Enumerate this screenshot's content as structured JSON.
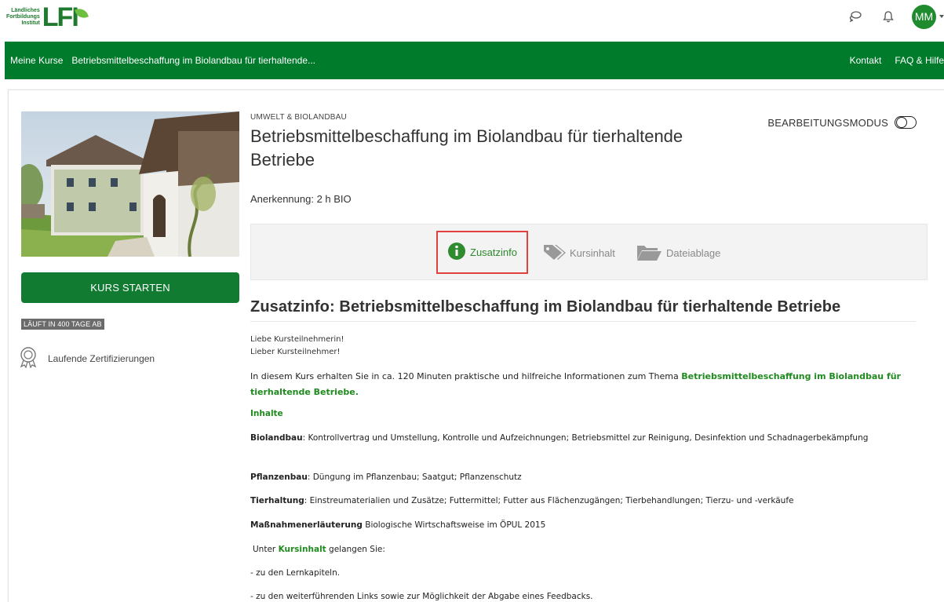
{
  "header": {
    "logo_text": [
      "Ländliches",
      "Fortbildungs",
      "Institut"
    ],
    "logo_mark": "LFI",
    "avatar_initials": "MM",
    "icons": [
      "chat-icon",
      "bell-icon"
    ]
  },
  "nav": {
    "home": "Meine Kurse",
    "breadcrumb": "Betriebsmittelbeschaffung im Biolandbau für tierhaltende...",
    "right": [
      "Kontakt",
      "FAQ & Hilfe"
    ]
  },
  "course": {
    "category": "UMWELT & BIOLANDBAU",
    "title": "Betriebsmittelbeschaffung im Biolandbau für tierhaltende Betriebe",
    "edit_mode_label": "BEARBEITUNGSMODUS",
    "recognition": "Anerkennung: 2 h BIO",
    "start_button": "KURS STARTEN",
    "runs_badge": "LÄUFT IN 400 TAGE AB",
    "certifications": "Laufende Zertifizierungen"
  },
  "tabs": [
    {
      "label": "Zusatzinfo",
      "icon": "info-icon",
      "active": true
    },
    {
      "label": "Kursinhalt",
      "icon": "tags-icon",
      "active": false
    },
    {
      "label": "Dateiablage",
      "icon": "folder-icon",
      "active": false
    }
  ],
  "section": {
    "heading": "Zusatzinfo: Betriebsmittelbeschaffung im Biolandbau für tierhaltende Betriebe",
    "greeting1": "Liebe Kursteilnehmerin!",
    "greeting2": "Lieber Kursteilnehmer!",
    "intro_start": "In diesem Kurs erhalten Sie in ca. 120 Minuten praktische und hilfreiche Informationen zum Thema ",
    "intro_topic": "Betriebsmittelbeschaffung im Biolandbau für tierhaltende Betriebe.",
    "contents_heading": "Inhalte",
    "items": [
      {
        "label": "Biolandbau",
        "text": ": Kontrollvertrag und Umstellung, Kontrolle und Aufzeichnungen; Betriebsmittel zur Reinigung, Desinfektion und Schadnagerbekämpfung"
      },
      {
        "label": "Pflanzenbau",
        "text": ": Düngung im Pflanzenbau; Saatgut; Pflanzenschutz"
      },
      {
        "label": "Tierhaltung",
        "text": ": Einstreumaterialien und Zusätze; Futtermittel; Futter aus Flächenzugängen; Tierbehandlungen; Tierzu- und -verkäufe"
      },
      {
        "label": "Maßnahmenerläuterung",
        "text": " Biologische Wirtschaftsweise im ÖPUL 2015"
      }
    ],
    "under_pre": "Unter ",
    "under_link": "Kursinhalt",
    "under_post": " gelangen Sie:",
    "bullet1": "- zu den Lernkapiteln.",
    "bullet2": "- zu den weiterführenden Links sowie zur Möglichkeit der Abgabe eines Feedbacks."
  },
  "colors": {
    "brand_green": "#007a2b",
    "button_green": "#117b32",
    "accent_green": "#1f8a1f",
    "highlight_red": "#e2403c"
  }
}
